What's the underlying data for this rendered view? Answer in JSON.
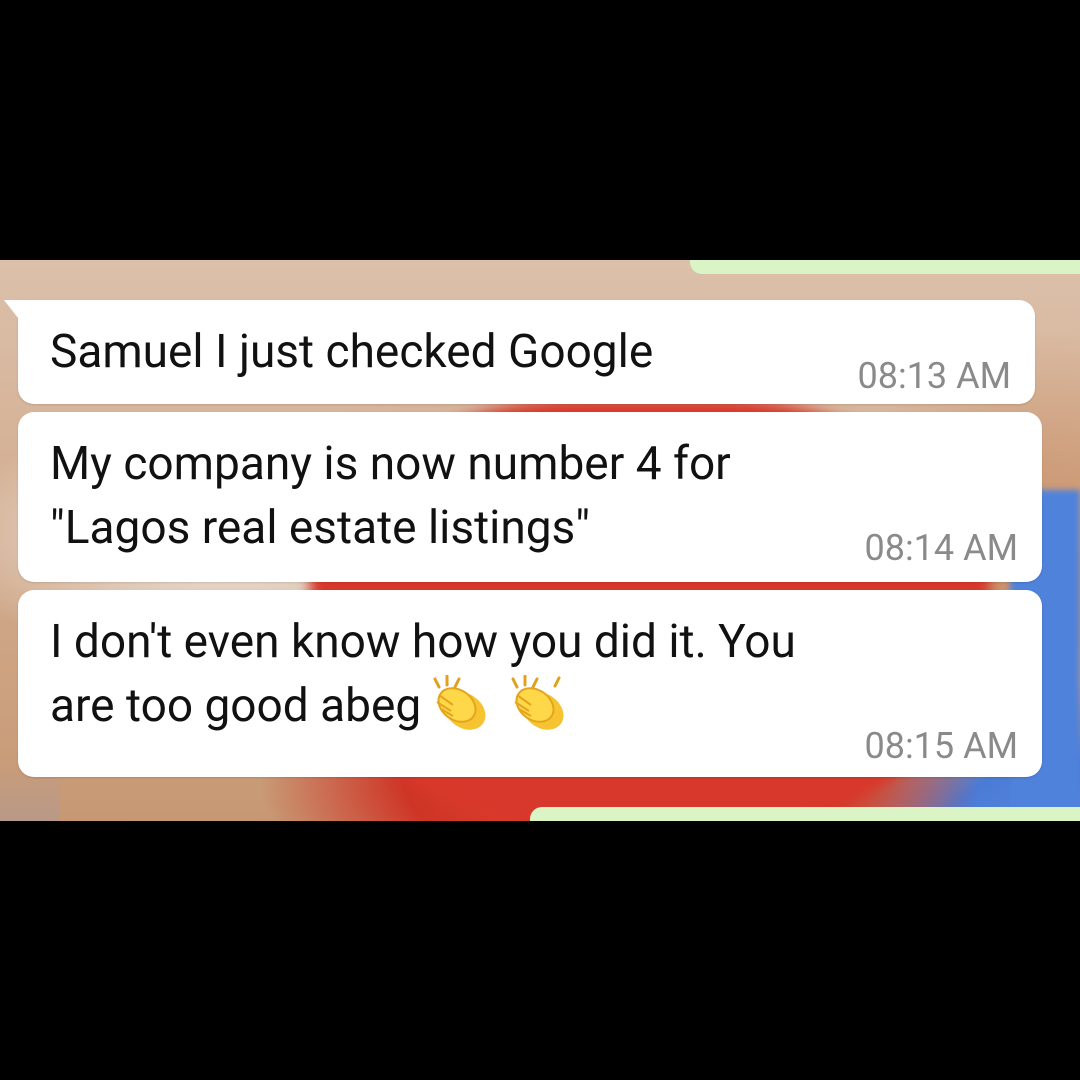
{
  "messages": [
    {
      "text": "Samuel I just checked Google",
      "time": "08:13 AM"
    },
    {
      "text": "My company is now number 4 for\n\"Lagos real estate listings\"",
      "time": "08:14 AM"
    },
    {
      "text_line1": "I don't even know how you did it. You",
      "text_line2": "are too good abeg",
      "emoji": "clapping-hands x2",
      "time": "08:15 AM"
    }
  ],
  "colors": {
    "incoming_bubble": "#ffffff",
    "outgoing_bubble": "#dbf4c6",
    "timestamp": "#8a8a8a",
    "frame": "#000000"
  }
}
